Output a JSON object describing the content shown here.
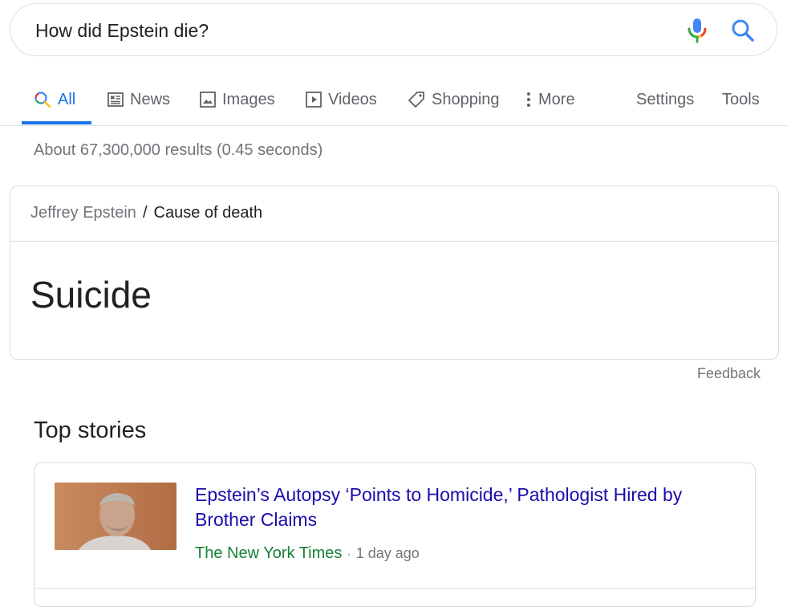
{
  "search": {
    "query": "How did Epstein die?",
    "mic_icon": "microphone-icon",
    "search_icon": "magnifier-icon"
  },
  "tabs": [
    {
      "label": "All",
      "icon": "search-icon",
      "active": true
    },
    {
      "label": "News",
      "icon": "news-icon"
    },
    {
      "label": "Images",
      "icon": "image-icon"
    },
    {
      "label": "Videos",
      "icon": "play-icon"
    },
    {
      "label": "Shopping",
      "icon": "tag-icon"
    },
    {
      "label": "More",
      "icon": "more-vert-icon"
    },
    {
      "label": "Settings"
    },
    {
      "label": "Tools"
    }
  ],
  "result_stats": "About 67,300,000 results (0.45 seconds)",
  "answer": {
    "breadcrumb": [
      "Jeffrey Epstein",
      "Cause of death"
    ],
    "separator": "/",
    "value": "Suicide"
  },
  "feedback_label": "Feedback",
  "top_stories": {
    "title": "Top stories",
    "items": [
      {
        "headline": "Epstein’s Autopsy ‘Points to Homicide,’ Pathologist Hired by Brother Claims",
        "source": "The New York Times",
        "separator": "·",
        "time": "1 day ago"
      }
    ]
  },
  "colors": {
    "link_blue": "#1a0dab",
    "active_blue": "#1a73e8",
    "source_green": "#188038",
    "muted_gray": "#70757a",
    "border_gray": "#dadce0"
  }
}
